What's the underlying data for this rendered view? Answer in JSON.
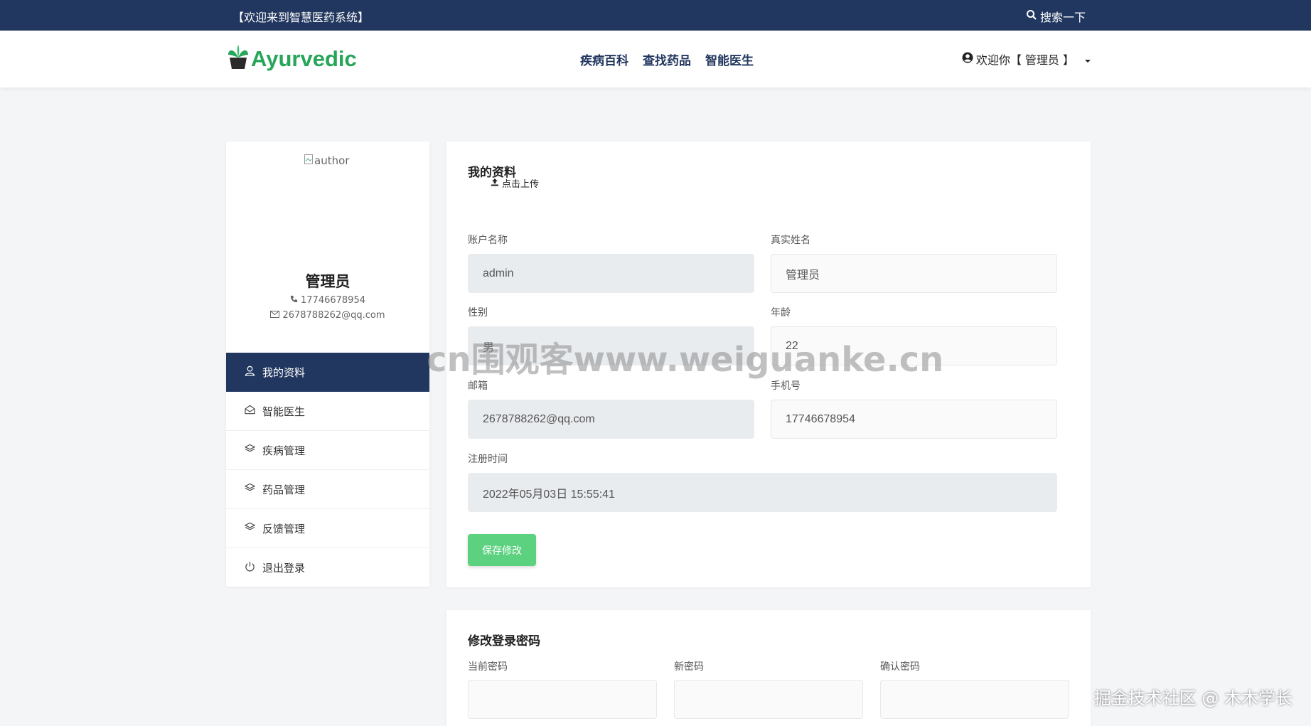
{
  "topbar": {
    "welcome": "【欢迎来到智慧医药系统】",
    "search_label": "搜索一下"
  },
  "navbar": {
    "logo_text": "Ayurvedic",
    "links": [
      "疾病百科",
      "查找药品",
      "智能医生"
    ],
    "user_greeting": "欢迎你【 管理员 】"
  },
  "sidebar": {
    "avatar_alt": "author",
    "name": "管理员",
    "phone": "17746678954",
    "email": "2678788262@qq.com",
    "menu": [
      {
        "label": "我的资料",
        "icon": "user-icon"
      },
      {
        "label": "智能医生",
        "icon": "envelope-open-icon"
      },
      {
        "label": "疾病管理",
        "icon": "layers-icon"
      },
      {
        "label": "药品管理",
        "icon": "layers-icon"
      },
      {
        "label": "反馈管理",
        "icon": "layers-icon"
      },
      {
        "label": "退出登录",
        "icon": "power-icon"
      }
    ]
  },
  "profile_form": {
    "title": "我的资料",
    "upload_label": "点击上传",
    "account_label": "账户名称",
    "account_value": "admin",
    "realname_label": "真实姓名",
    "realname_value": "管理员",
    "gender_label": "性别",
    "gender_value": "男",
    "age_label": "年龄",
    "age_value": "22",
    "email_label": "邮箱",
    "email_value": "2678788262@qq.com",
    "phone_label": "手机号",
    "phone_value": "17746678954",
    "regtime_label": "注册时间",
    "regtime_value": "2022年05月03日 15:55:41",
    "save_label": "保存修改"
  },
  "password_form": {
    "title": "修改登录密码",
    "current_label": "当前密码",
    "new_label": "新密码",
    "confirm_label": "确认密码"
  },
  "overlay": {
    "watermark": "cn围观客www.weiguanke.cn",
    "credit": "掘金技术社区 @ 木木学长"
  },
  "colors": {
    "primary": "#22375f",
    "accent_green": "#5cd17f",
    "logo_green": "#27a65a"
  }
}
